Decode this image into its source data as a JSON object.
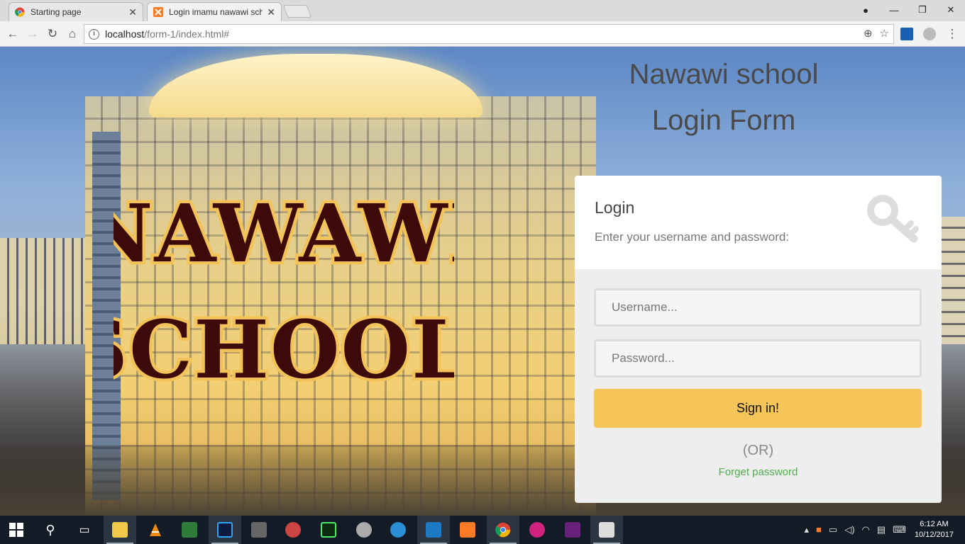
{
  "browser": {
    "tabs": [
      {
        "label": "Starting page",
        "active": false
      },
      {
        "label": "Login imamu nawawi sch",
        "active": true
      }
    ],
    "url_host": "localhost",
    "url_path": "/form-1/index.html#"
  },
  "page": {
    "logo_line1": "NAWAWI",
    "logo_line2": "SCHOOL",
    "heading_line1": "Nawawi school",
    "heading_line2": "Login Form"
  },
  "login": {
    "title": "Login",
    "subtitle": "Enter your username and password:",
    "username_placeholder": "Username...",
    "password_placeholder": "Password...",
    "signin_label": "Sign in!",
    "or_text": "(OR)",
    "forget_label": "Forget password"
  },
  "taskbar": {
    "time": "6:12 AM",
    "date": "10/12/2017"
  },
  "colors": {
    "signin_bg": "#f5c55a",
    "forget_link": "#4cae4c",
    "logo_fill": "#3d0a0a",
    "logo_outline": "#f3c35a"
  }
}
